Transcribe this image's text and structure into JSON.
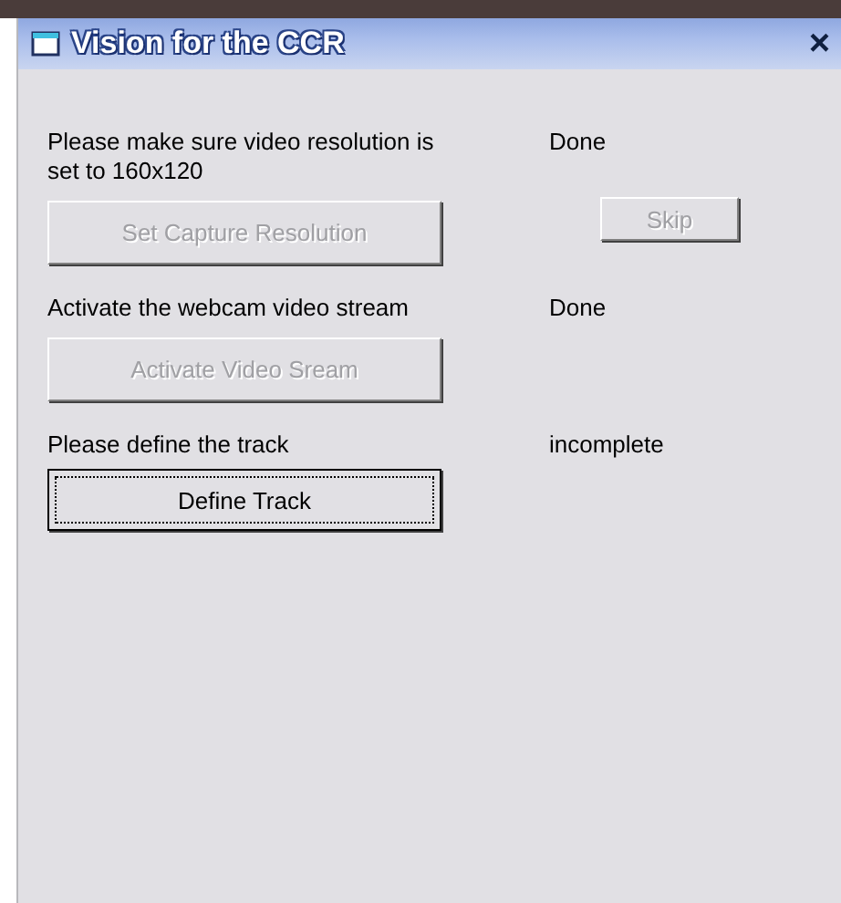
{
  "window": {
    "title": "Vision for the CCR",
    "close": "×"
  },
  "steps": [
    {
      "label": "Please make sure video resolution is set to 160x120",
      "status": "Done",
      "button": {
        "label": "Set Capture Resolution",
        "disabled": true,
        "focused": false
      },
      "side_button": {
        "label": "Skip",
        "disabled": true
      }
    },
    {
      "label": "Activate the webcam video stream",
      "status": "Done",
      "button": {
        "label": "Activate Video Sream",
        "disabled": true,
        "focused": false
      }
    },
    {
      "label": "Please define the track",
      "status": "incomplete",
      "button": {
        "label": "Define Track",
        "disabled": false,
        "focused": true
      }
    }
  ]
}
